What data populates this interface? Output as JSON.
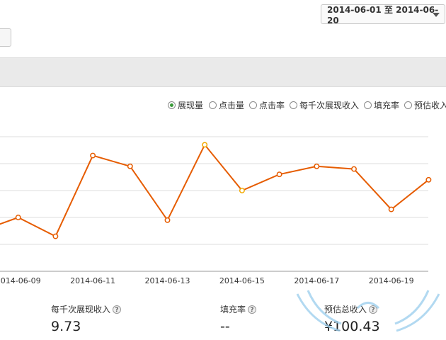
{
  "date_range": {
    "label": "2014-06-01 至 2014-06-20"
  },
  "legend": [
    {
      "label": "展现量",
      "checked": true
    },
    {
      "label": "点击量",
      "checked": false
    },
    {
      "label": "点击率",
      "checked": false
    },
    {
      "label": "每千次展现收入",
      "checked": false
    },
    {
      "label": "填充率",
      "checked": false
    },
    {
      "label": "预估收入",
      "checked": false
    }
  ],
  "chart_data": {
    "type": "line",
    "x": [
      "2014-06-08",
      "2014-06-09",
      "2014-06-10",
      "2014-06-11",
      "2014-06-12",
      "2014-06-13",
      "2014-06-14",
      "2014-06-15",
      "2014-06-16",
      "2014-06-17",
      "2014-06-18",
      "2014-06-19",
      "2014-06-20"
    ],
    "xtick_labels": [
      "2014-06-09",
      "2014-06-11",
      "2014-06-13",
      "2014-06-15",
      "2014-06-17",
      "2014-06-19"
    ],
    "series": [
      {
        "values": [
          1.5,
          2.0,
          1.3,
          4.3,
          3.9,
          1.9,
          4.7,
          3.0,
          3.6,
          3.9,
          3.8,
          2.3,
          3.4
        ]
      }
    ],
    "ylim": [
      0,
      5
    ],
    "grid": true,
    "highlighted_points": [
      "2014-06-14",
      "2014-06-15"
    ],
    "colors": {
      "line": "#e65c00",
      "highlight": "#f2a900",
      "grid": "#dddddd"
    }
  },
  "stats": {
    "ecpm": {
      "label": "每千次展现收入",
      "value": "9.73"
    },
    "fill_rate": {
      "label": "填充率",
      "value": "--"
    },
    "est_total": {
      "label": "预估总收入",
      "value": "¥100.43"
    }
  },
  "help_glyph": "?"
}
